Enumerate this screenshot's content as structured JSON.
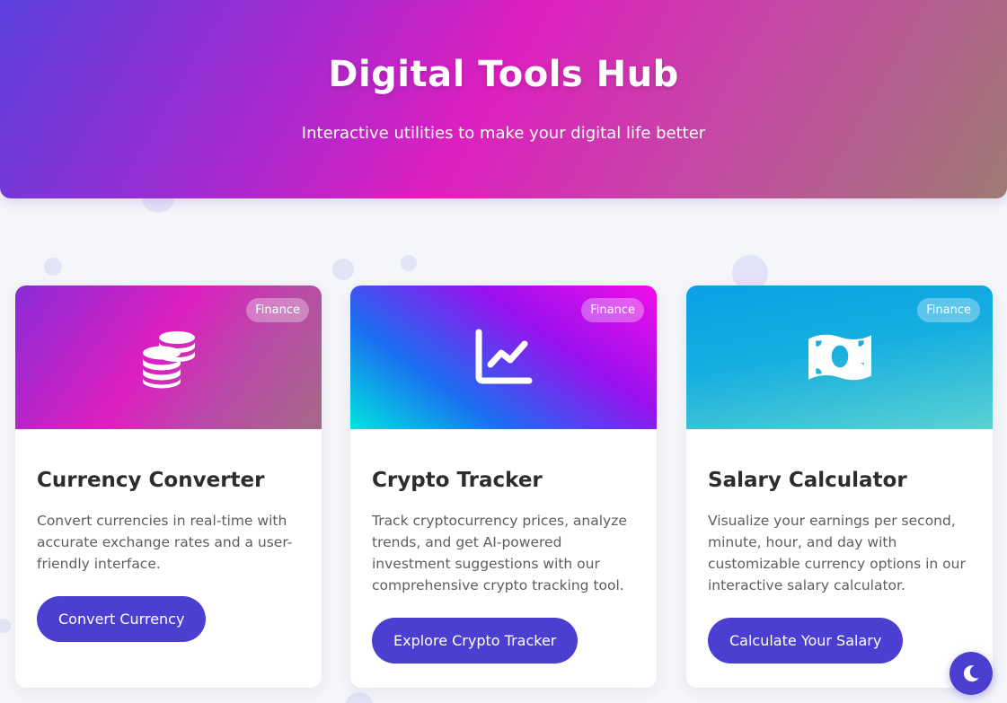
{
  "hero": {
    "title": "Digital Tools Hub",
    "subtitle": "Interactive utilities to make your digital life better"
  },
  "cards": [
    {
      "badge": "Finance",
      "icon": "coins-icon",
      "title": "Currency Converter",
      "description": "Convert currencies in real-time with accurate exchange rates and a user-friendly interface.",
      "button": "Convert Currency"
    },
    {
      "badge": "Finance",
      "icon": "chart-line-icon",
      "title": "Crypto Tracker",
      "description": "Track cryptocurrency prices, analyze trends, and get AI-powered investment suggestions with our comprehensive crypto tracking tool.",
      "button": "Explore Crypto Tracker"
    },
    {
      "badge": "Finance",
      "icon": "money-bill-icon",
      "title": "Salary Calculator",
      "description": "Visualize your earnings per second, minute, hour, and day with customizable currency options in our interactive salary calculator.",
      "button": "Calculate Your Salary"
    }
  ],
  "theme_toggle": {
    "icon": "moon-icon"
  },
  "colors": {
    "accent": "#4a3fd0",
    "background": "#f5f6fa",
    "card": "#ffffff"
  }
}
